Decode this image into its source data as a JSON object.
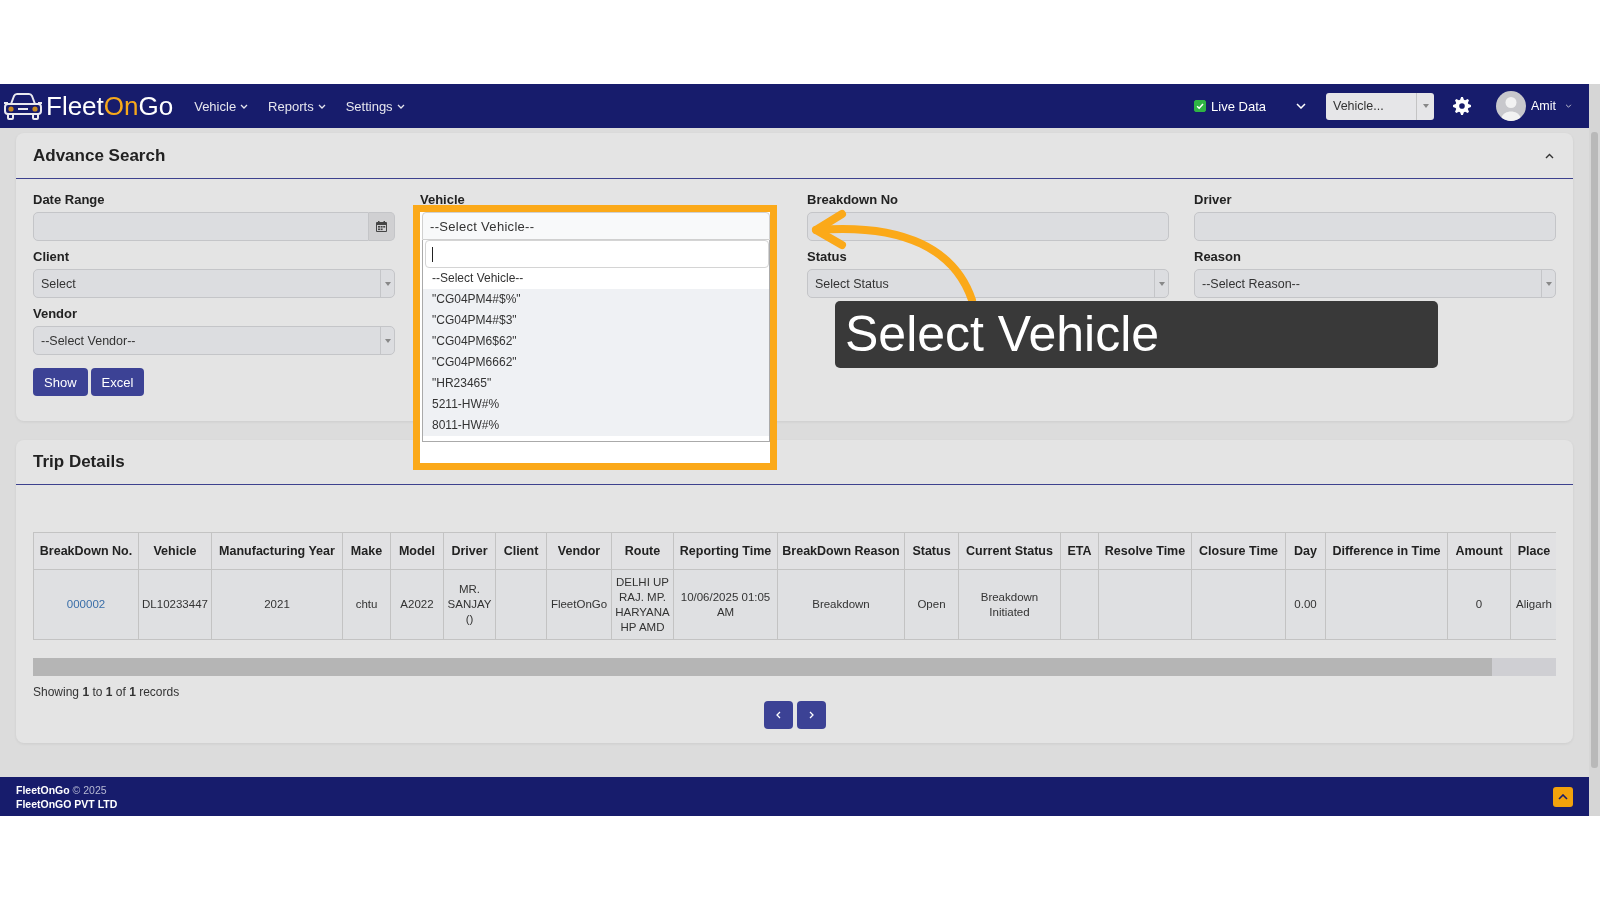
{
  "navbar": {
    "logo": {
      "parts": [
        {
          "text": "Fleet",
          "color": "#ffffff"
        },
        {
          "text": "On",
          "color": "#f7a81b"
        },
        {
          "text": "Go",
          "color": "#ffffff"
        }
      ]
    },
    "menu": [
      {
        "label": "Vehicle"
      },
      {
        "label": "Reports"
      },
      {
        "label": "Settings"
      }
    ],
    "live_data": {
      "label": "Live Data",
      "checked": true
    },
    "vehicle_select": {
      "value": "Vehicle..."
    },
    "user": {
      "name": "Amit"
    }
  },
  "advance_search": {
    "title": "Advance Search",
    "expanded": true,
    "columns": [
      {
        "fields": [
          {
            "label": "Date Range",
            "kind": "date",
            "highlighted": false
          },
          {
            "label": "Client",
            "kind": "select",
            "value": "Select",
            "highlighted": false,
            "expanded": false
          },
          {
            "label": "Vendor",
            "kind": "select",
            "value": "--Select Vendor--",
            "highlighted": false,
            "expanded": false
          }
        ],
        "buttons": [
          "Show",
          "Excel"
        ]
      },
      {
        "fields": [
          {
            "label": "Vehicle",
            "kind": "select",
            "value": "--Select Vehicle--",
            "highlighted": true,
            "expanded": true,
            "options": [
              {
                "label": "--Select Vehicle--",
                "selected": true
              },
              {
                "label": "\"CG04PM4#$%\"",
                "selected": false
              },
              {
                "label": "\"CG04PM4#$3\"",
                "selected": false
              },
              {
                "label": "\"CG04PM6$62\"",
                "selected": false
              },
              {
                "label": "\"CG04PM6662\"",
                "selected": false
              },
              {
                "label": "\"HR23465\"",
                "selected": false
              },
              {
                "label": "5211-HW#%",
                "selected": false
              },
              {
                "label": "8011-HW#%",
                "selected": false
              }
            ]
          }
        ]
      },
      {
        "fields": [
          {
            "label": "Breakdown No",
            "kind": "text",
            "highlighted": false
          },
          {
            "label": "Status",
            "kind": "select",
            "value": "Select Status",
            "highlighted": false,
            "expanded": false
          }
        ]
      },
      {
        "fields": [
          {
            "label": "Driver",
            "kind": "text",
            "highlighted": false
          },
          {
            "label": "Reason",
            "kind": "select",
            "value": "--Select Reason--",
            "highlighted": false,
            "expanded": false
          }
        ]
      }
    ]
  },
  "callout": {
    "text": "Select Vehicle"
  },
  "trip_details": {
    "title": "Trip Details",
    "table": {
      "columns": [
        "BreakDown No.",
        "Vehicle",
        "Manufacturing Year",
        "Make",
        "Model",
        "Driver",
        "Client",
        "Vendor",
        "Route",
        "Reporting Time",
        "BreakDown Reason",
        "Status",
        "Current Status",
        "ETA",
        "Resolve Time",
        "Closure Time",
        "Day",
        "Difference in Time",
        "Amount",
        "Place"
      ],
      "rows": [
        {
          "cells": [
            {
              "text": "000002",
              "kind": "link"
            },
            {
              "text": "DL10233447",
              "kind": "text"
            },
            {
              "text": "2021",
              "kind": "text"
            },
            {
              "text": "chtu",
              "kind": "text"
            },
            {
              "text": "A2022",
              "kind": "text"
            },
            {
              "text": "MR. SANJAY ()",
              "kind": "text"
            },
            null,
            {
              "text": "FleetOnGo",
              "kind": "text"
            },
            {
              "text": "DELHI UP RAJ. MP. HARYANA HP AMD",
              "kind": "text"
            },
            {
              "text": "10/06/2025 01:05 AM",
              "kind": "text"
            },
            {
              "text": "Breakdown",
              "kind": "text"
            },
            {
              "text": "Open",
              "kind": "text"
            },
            {
              "text": "Breakdown Initiated",
              "kind": "text"
            },
            null,
            null,
            null,
            {
              "text": "0.00",
              "kind": "text"
            },
            null,
            {
              "text": "0",
              "kind": "text"
            },
            {
              "text": "Aligarh",
              "kind": "text"
            }
          ]
        }
      ]
    },
    "summary": "Showing **1** to **1** of **1** records",
    "pagination": [
      {
        "kind": "prev"
      },
      {
        "kind": "next"
      }
    ]
  },
  "footer": {
    "copyright": "**FleetOnGo** © 2025",
    "company": "FleetOnGO PVT LTD"
  }
}
